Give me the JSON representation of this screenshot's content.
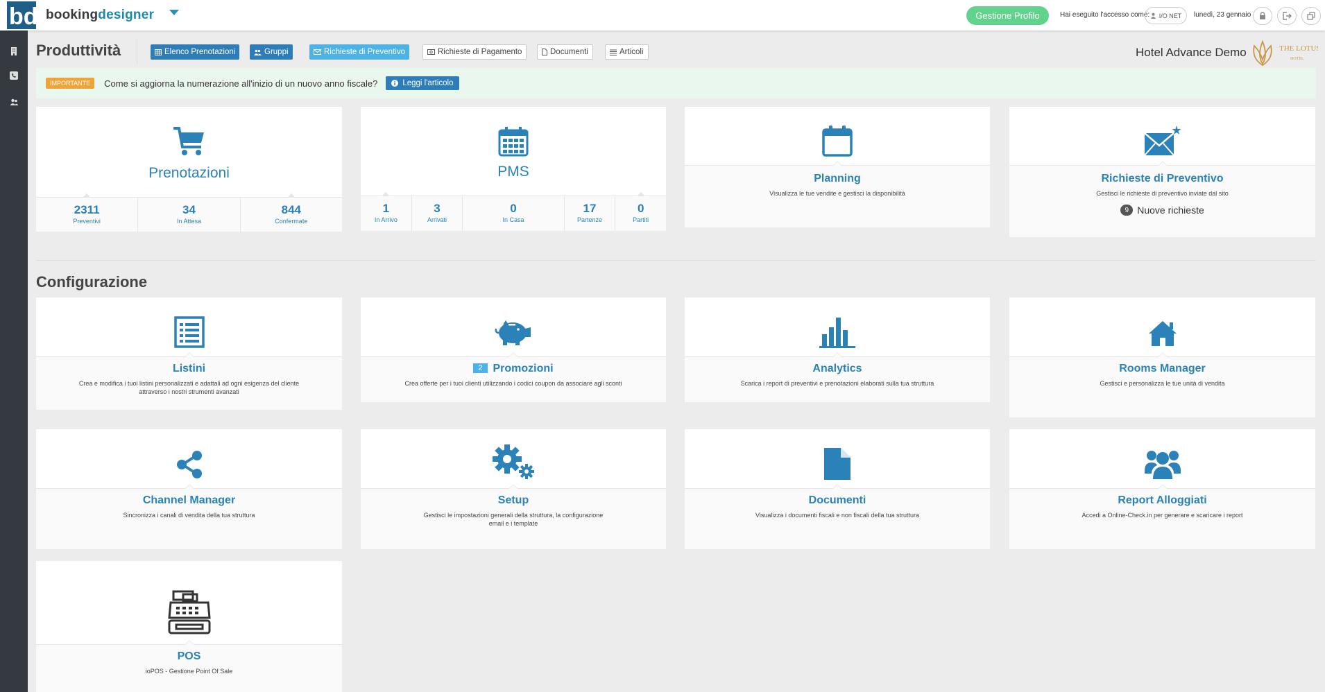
{
  "brand": {
    "part1": "booking",
    "part2": "designer"
  },
  "topbar": {
    "profile_button": "Gestione Profilo",
    "access_label": "Hai eseguito l'accesso come:",
    "user": "I/O NET",
    "date": "lunedì, 23 gennaio"
  },
  "header": {
    "title": "Produttività",
    "nav": [
      {
        "label": "Elenco Prenotazioni",
        "icon": "table-icon"
      },
      {
        "label": "Gruppi",
        "icon": "users-icon"
      },
      {
        "label": "Richieste di Preventivo",
        "icon": "envelope-icon"
      },
      {
        "label": "Richieste di Pagamento",
        "icon": "money-icon"
      },
      {
        "label": "Documenti",
        "icon": "file-icon"
      },
      {
        "label": "Articoli",
        "icon": "list-icon"
      }
    ],
    "hotel_name": "Hotel Advance Demo",
    "hotel_logo_text": "THE LOTUS",
    "hotel_logo_sub": "HOTEL"
  },
  "alert": {
    "badge": "IMPORTANTE",
    "text": "Come si aggiorna la numerazione all'inizio di un nuovo anno fiscale?",
    "button": "Leggi l'articolo"
  },
  "productivity": {
    "prenotazioni": {
      "label": "Prenotazioni",
      "stats": [
        {
          "value": "2311",
          "label": "Preventivi"
        },
        {
          "value": "34",
          "label": "In Attesa"
        },
        {
          "value": "844",
          "label": "Confermate"
        }
      ]
    },
    "pms": {
      "label": "PMS",
      "stats": [
        {
          "value": "1",
          "label": "In Arrivo"
        },
        {
          "value": "3",
          "label": "Arrivati"
        },
        {
          "value": "0",
          "label": "In Casa"
        },
        {
          "value": "17",
          "label": "Partenze"
        },
        {
          "value": "0",
          "label": "Partiti"
        }
      ]
    },
    "planning": {
      "title": "Planning",
      "desc": "Visualizza le tue vendite e gestisci la disponibilità"
    },
    "preventivo": {
      "title": "Richieste di Preventivo",
      "desc": "Gestisci le richieste di preventivo inviate dal sito",
      "new_count": "9",
      "new_label": "Nuove richieste"
    }
  },
  "config": {
    "title": "Configurazione",
    "listini": {
      "title": "Listini",
      "desc": "Crea e modifica i tuoi listini personalizzati e adattali ad ogni esigenza del cliente attraverso i nostri strumenti avanzati"
    },
    "promozioni": {
      "title": "Promozioni",
      "count": "2",
      "desc": "Crea offerte per i tuoi clienti utilizzando i codici coupon da associare agli sconti"
    },
    "analytics": {
      "title": "Analytics",
      "desc": "Scarica i report di preventivi e prenotazioni elaborati sulla tua struttura"
    },
    "rooms": {
      "title": "Rooms Manager",
      "desc": "Gestisci e personalizza le tue unità di vendita"
    },
    "channel": {
      "title": "Channel Manager",
      "desc": "Sincronizza i canali di vendita della tua struttura"
    },
    "setup": {
      "title": "Setup",
      "desc": "Gestisci le impostazioni generali della struttura, la configurazione email e i template"
    },
    "documenti": {
      "title": "Documenti",
      "desc": "Visualizza i documenti fiscali e non fiscali della tua struttura"
    },
    "report": {
      "title": "Report Alloggiati",
      "desc": "Accedi a Online-Check.in per generare e scaricare i report"
    },
    "pos": {
      "title": "POS",
      "desc": "ioPOS - Gestione Point Of Sale"
    }
  },
  "colors": {
    "accent": "#2a82b8",
    "profile_green": "#62d38c",
    "alert_bg": "#eaf7ee",
    "sidebar": "#343a40"
  }
}
